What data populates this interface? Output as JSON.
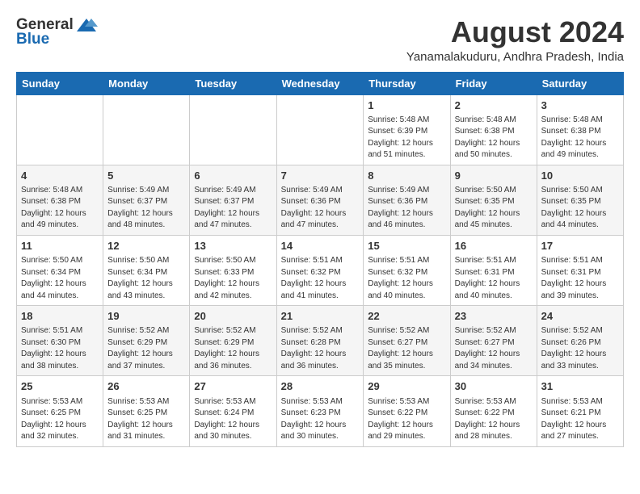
{
  "header": {
    "logo_general": "General",
    "logo_blue": "Blue",
    "month_year": "August 2024",
    "location": "Yanamalakuduru, Andhra Pradesh, India"
  },
  "calendar": {
    "days_of_week": [
      "Sunday",
      "Monday",
      "Tuesday",
      "Wednesday",
      "Thursday",
      "Friday",
      "Saturday"
    ],
    "weeks": [
      [
        {
          "day": "",
          "info": ""
        },
        {
          "day": "",
          "info": ""
        },
        {
          "day": "",
          "info": ""
        },
        {
          "day": "",
          "info": ""
        },
        {
          "day": "1",
          "info": "Sunrise: 5:48 AM\nSunset: 6:39 PM\nDaylight: 12 hours\nand 51 minutes."
        },
        {
          "day": "2",
          "info": "Sunrise: 5:48 AM\nSunset: 6:38 PM\nDaylight: 12 hours\nand 50 minutes."
        },
        {
          "day": "3",
          "info": "Sunrise: 5:48 AM\nSunset: 6:38 PM\nDaylight: 12 hours\nand 49 minutes."
        }
      ],
      [
        {
          "day": "4",
          "info": "Sunrise: 5:48 AM\nSunset: 6:38 PM\nDaylight: 12 hours\nand 49 minutes."
        },
        {
          "day": "5",
          "info": "Sunrise: 5:49 AM\nSunset: 6:37 PM\nDaylight: 12 hours\nand 48 minutes."
        },
        {
          "day": "6",
          "info": "Sunrise: 5:49 AM\nSunset: 6:37 PM\nDaylight: 12 hours\nand 47 minutes."
        },
        {
          "day": "7",
          "info": "Sunrise: 5:49 AM\nSunset: 6:36 PM\nDaylight: 12 hours\nand 47 minutes."
        },
        {
          "day": "8",
          "info": "Sunrise: 5:49 AM\nSunset: 6:36 PM\nDaylight: 12 hours\nand 46 minutes."
        },
        {
          "day": "9",
          "info": "Sunrise: 5:50 AM\nSunset: 6:35 PM\nDaylight: 12 hours\nand 45 minutes."
        },
        {
          "day": "10",
          "info": "Sunrise: 5:50 AM\nSunset: 6:35 PM\nDaylight: 12 hours\nand 44 minutes."
        }
      ],
      [
        {
          "day": "11",
          "info": "Sunrise: 5:50 AM\nSunset: 6:34 PM\nDaylight: 12 hours\nand 44 minutes."
        },
        {
          "day": "12",
          "info": "Sunrise: 5:50 AM\nSunset: 6:34 PM\nDaylight: 12 hours\nand 43 minutes."
        },
        {
          "day": "13",
          "info": "Sunrise: 5:50 AM\nSunset: 6:33 PM\nDaylight: 12 hours\nand 42 minutes."
        },
        {
          "day": "14",
          "info": "Sunrise: 5:51 AM\nSunset: 6:32 PM\nDaylight: 12 hours\nand 41 minutes."
        },
        {
          "day": "15",
          "info": "Sunrise: 5:51 AM\nSunset: 6:32 PM\nDaylight: 12 hours\nand 40 minutes."
        },
        {
          "day": "16",
          "info": "Sunrise: 5:51 AM\nSunset: 6:31 PM\nDaylight: 12 hours\nand 40 minutes."
        },
        {
          "day": "17",
          "info": "Sunrise: 5:51 AM\nSunset: 6:31 PM\nDaylight: 12 hours\nand 39 minutes."
        }
      ],
      [
        {
          "day": "18",
          "info": "Sunrise: 5:51 AM\nSunset: 6:30 PM\nDaylight: 12 hours\nand 38 minutes."
        },
        {
          "day": "19",
          "info": "Sunrise: 5:52 AM\nSunset: 6:29 PM\nDaylight: 12 hours\nand 37 minutes."
        },
        {
          "day": "20",
          "info": "Sunrise: 5:52 AM\nSunset: 6:29 PM\nDaylight: 12 hours\nand 36 minutes."
        },
        {
          "day": "21",
          "info": "Sunrise: 5:52 AM\nSunset: 6:28 PM\nDaylight: 12 hours\nand 36 minutes."
        },
        {
          "day": "22",
          "info": "Sunrise: 5:52 AM\nSunset: 6:27 PM\nDaylight: 12 hours\nand 35 minutes."
        },
        {
          "day": "23",
          "info": "Sunrise: 5:52 AM\nSunset: 6:27 PM\nDaylight: 12 hours\nand 34 minutes."
        },
        {
          "day": "24",
          "info": "Sunrise: 5:52 AM\nSunset: 6:26 PM\nDaylight: 12 hours\nand 33 minutes."
        }
      ],
      [
        {
          "day": "25",
          "info": "Sunrise: 5:53 AM\nSunset: 6:25 PM\nDaylight: 12 hours\nand 32 minutes."
        },
        {
          "day": "26",
          "info": "Sunrise: 5:53 AM\nSunset: 6:25 PM\nDaylight: 12 hours\nand 31 minutes."
        },
        {
          "day": "27",
          "info": "Sunrise: 5:53 AM\nSunset: 6:24 PM\nDaylight: 12 hours\nand 30 minutes."
        },
        {
          "day": "28",
          "info": "Sunrise: 5:53 AM\nSunset: 6:23 PM\nDaylight: 12 hours\nand 30 minutes."
        },
        {
          "day": "29",
          "info": "Sunrise: 5:53 AM\nSunset: 6:22 PM\nDaylight: 12 hours\nand 29 minutes."
        },
        {
          "day": "30",
          "info": "Sunrise: 5:53 AM\nSunset: 6:22 PM\nDaylight: 12 hours\nand 28 minutes."
        },
        {
          "day": "31",
          "info": "Sunrise: 5:53 AM\nSunset: 6:21 PM\nDaylight: 12 hours\nand 27 minutes."
        }
      ]
    ]
  }
}
